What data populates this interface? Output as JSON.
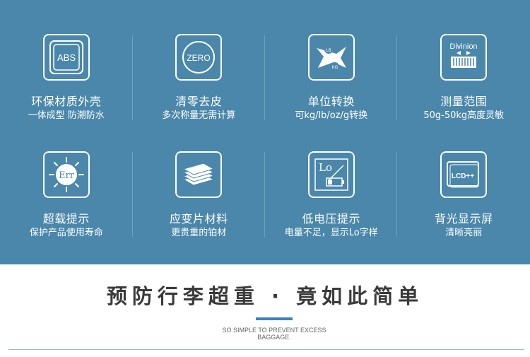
{
  "features": [
    {
      "icon": "abs-shell-icon",
      "badge": "ABS",
      "title": "环保材质外壳",
      "sub": "一体成型 防潮防水"
    },
    {
      "icon": "zero-tare-icon",
      "badge": "ZERO",
      "title": "清零去皮",
      "sub": "多次称量无需计算"
    },
    {
      "icon": "unit-convert-icon",
      "badge_a": "LB",
      "badge_b": "KG",
      "title": "单位转换",
      "sub": "可kg/lb/oz/g转换"
    },
    {
      "icon": "division-scale-icon",
      "badge": "Divinion",
      "title": "测量范围",
      "sub": "50g-50kg高度灵敏"
    },
    {
      "icon": "overload-err-icon",
      "badge": "Err",
      "title": "超载提示",
      "sub": "保护产品使用寿命"
    },
    {
      "icon": "steel-plate-icon",
      "title": "应变片材料",
      "sub": "更贵重的铂材"
    },
    {
      "icon": "low-voltage-icon",
      "badge": "Lo",
      "title": "低电压提示",
      "sub": "电量不足，显示Lo字样"
    },
    {
      "icon": "lcd-backlight-icon",
      "badge": "LCD++",
      "title": "背光显示屏",
      "sub": "清晰亮丽"
    }
  ],
  "headline": "预防行李超重 · 竟如此简单",
  "subline": "SO SIMPLE TO PREVENT EXCESS BAGGAGE.",
  "colors": {
    "panel": "#4a87ab",
    "accent": "#3b7fc6",
    "headline": "#3a3a3a"
  }
}
